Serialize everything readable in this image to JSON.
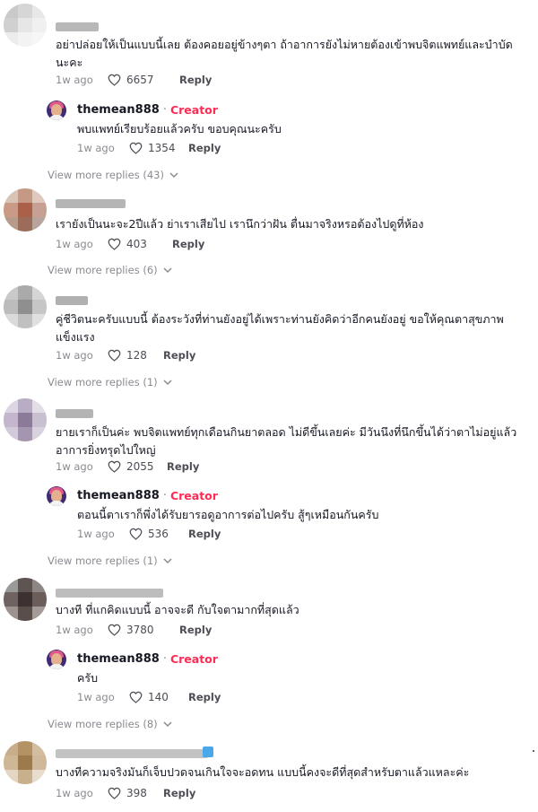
{
  "comments": [
    {
      "text": "อย่าปล่อยให้เป็นแบบนี้เลย ต้องคอยอยู่ข้างๆตา ถ้าอาการยังไม่หายต้องเข้าพบจิตแพทย์และบำบัด นะคะ",
      "time": "1w ago",
      "likes": "6657",
      "reply": "Reply",
      "creator_reply": {
        "name": "themean888",
        "sep": "·",
        "badge": "Creator",
        "text": "พบแพทย์เรียบร้อยแล้วครับ ขอบคุณนะครับ",
        "time": "1w ago",
        "likes": "1354",
        "reply": "Reply"
      },
      "view_more": "View more replies (43)"
    },
    {
      "text": "เรายังเป็นนะจะ2ปีแล้ว ย่าเราเสียไป เรานึกว่าฝัน ตื่นมาจริงหรอต้องไปดูที่ห้อง",
      "time": "1w ago",
      "likes": "403",
      "reply": "Reply",
      "view_more": "View more replies (6)"
    },
    {
      "text": "คู่ชีวิตนะครับแบบนี้ ต้องระวังที่ท่านยังอยู่ได้เพราะท่านยังคิดว่าอีกคนยังอยู่ ขอให้คุณตาสุขภาพ แข็งแรง",
      "time": "1w ago",
      "likes": "128",
      "reply": "Reply",
      "view_more": "View more replies (1)"
    },
    {
      "text": "ยายเราก็เป็นค่ะ พบจิตแพทย์ทุกเดือนกินยาตลอด ไม่ดีขึ้นเลยค่ะ มีวันนึงที่นึกขึ้นได้ว่าตาไม่อยู่แล้ว อาการยิ่งทรุดไปใหญ่",
      "time": "1w ago",
      "likes": "2055",
      "reply": "Reply",
      "creator_reply": {
        "name": "themean888",
        "sep": "·",
        "badge": "Creator",
        "text": "ตอนนี้ตาเราก็พึ่งได้รับยารอดูอาการต่อไปครับ สู้ๆเหมือนกันครับ",
        "time": "1w ago",
        "likes": "536",
        "reply": "Reply"
      },
      "view_more": "View more replies (1)"
    },
    {
      "text": "บางที ที่แกคิดแบบนี้ อาจจะดี กับใจตามากที่สุดแล้ว",
      "time": "1w ago",
      "likes": "3780",
      "reply": "Reply",
      "creator_reply": {
        "name": "themean888",
        "sep": "·",
        "badge": "Creator",
        "text": "ครับ",
        "time": "1w ago",
        "likes": "140",
        "reply": "Reply"
      },
      "view_more": "View more replies (8)"
    },
    {
      "text": "บางทีความจริงมันก็เจ็บปวดจนเกินใจจะอดทน แบบนี้คงจะดีที่สุดสำหรับตาแล้วแหละค่ะ",
      "time": "1w ago",
      "likes": "398",
      "reply": "Reply"
    }
  ],
  "colors": {
    "creator_badge": "#fe2c55",
    "meta_gray": "#8a8b91",
    "text": "#161823"
  },
  "icons": {
    "like": "heart-outline-icon",
    "expand": "chevron-down-icon"
  }
}
